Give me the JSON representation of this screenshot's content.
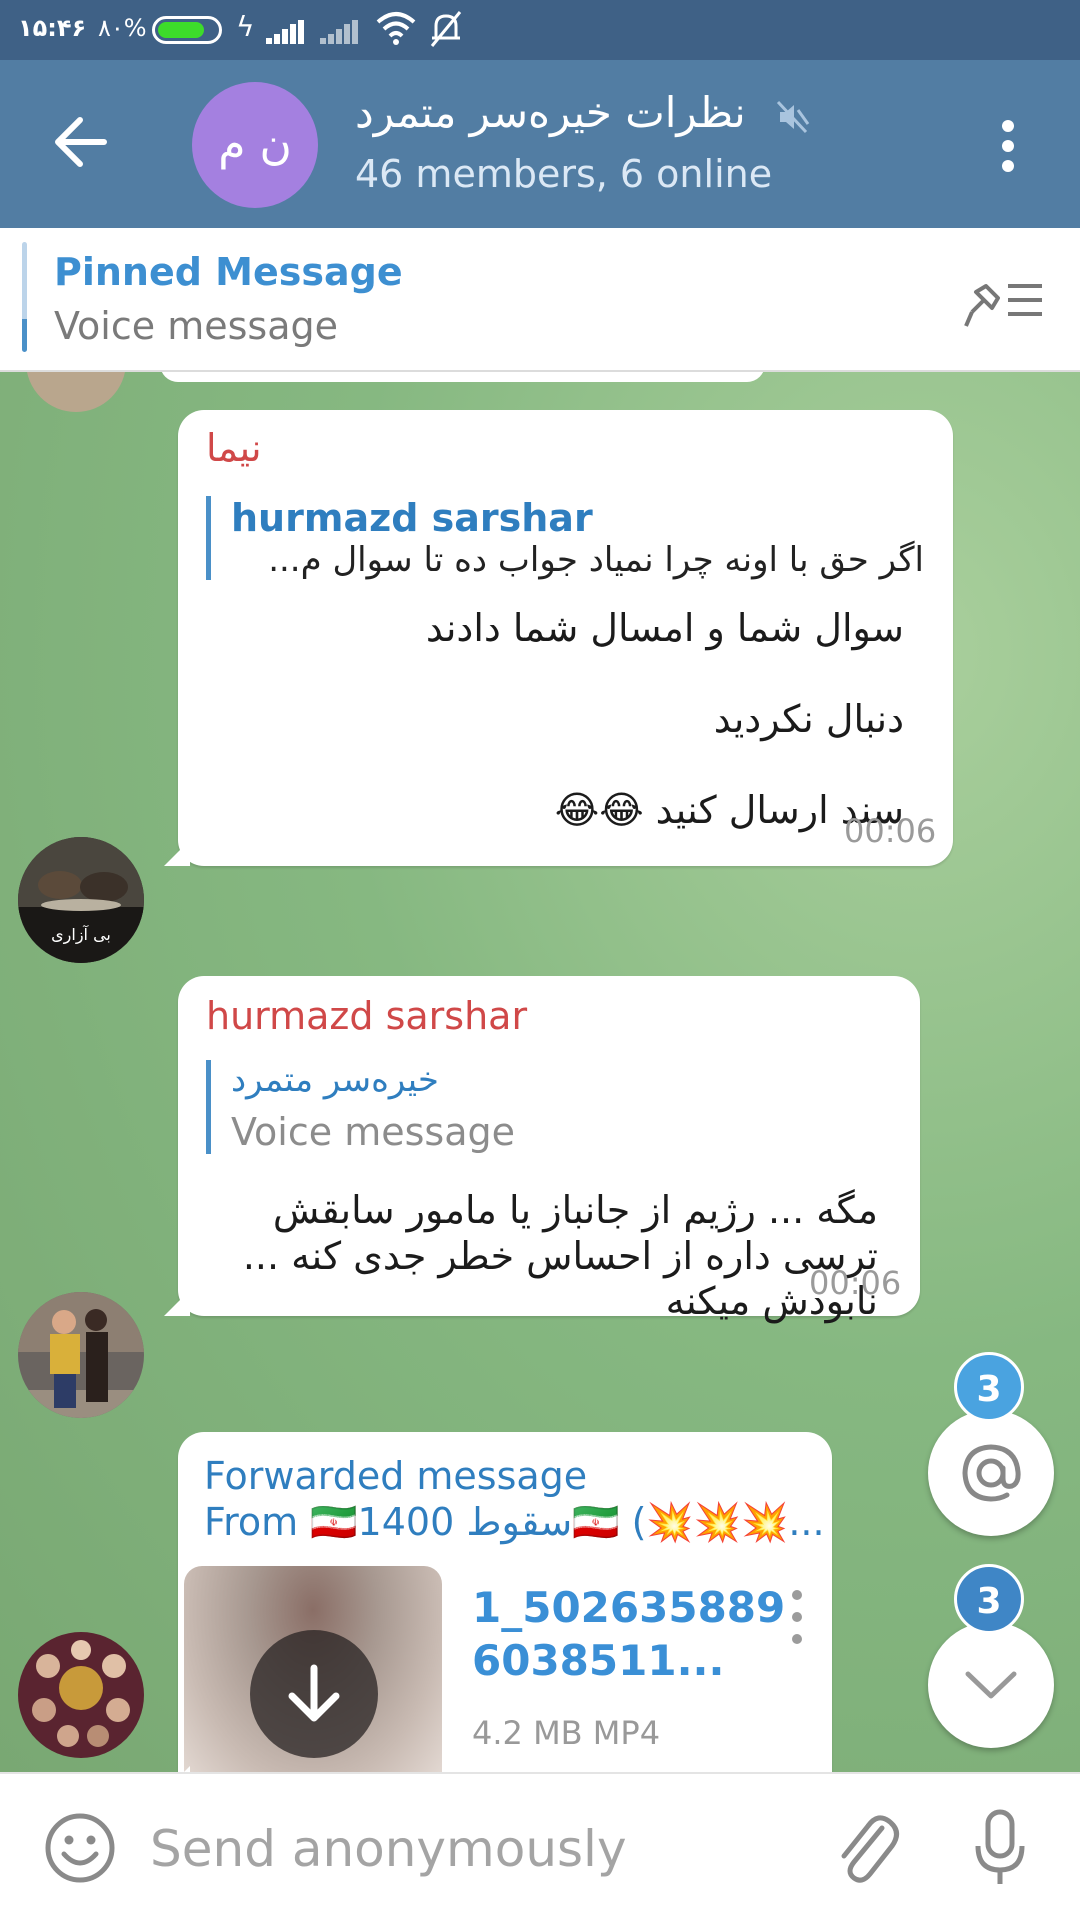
{
  "status_bar": {
    "time": "۱۵:۴۶",
    "battery_percent": "۸۰%",
    "battery_level": 0.8
  },
  "header": {
    "avatar_initials": "ن م",
    "title": "نظرات خیره‌سر متمرد",
    "subtitle": "46 members, 6 online"
  },
  "pinned": {
    "title": "Pinned Message",
    "text": "Voice message"
  },
  "messages": [
    {
      "sender": "نیما",
      "sender_color": "#d04848",
      "reply_name": "hurmazd sarshar",
      "reply_text": "اگر حق با اونه چرا نمیاد جواب ده تا سوال م...",
      "text": "سوال شما و امسال شما دادند\n\nدنبال نکردید\n\nسند ارسال کنید 😂😂",
      "time": "00:06",
      "avatar_label": "بی آزاری"
    },
    {
      "sender": "hurmazd sarshar",
      "sender_color": "#d04848",
      "reply_name": "خیره‌سر متمرد",
      "reply_text": "Voice message",
      "text": "مگه ... رژیم از جانباز یا مامور سابقش\nترسی داره از احساس خطر جدی کنه ...\nنابودش میکنه",
      "time": "00:06"
    },
    {
      "forward_label": "Forwarded message",
      "forward_from": "From 🇮🇷1400 سقوط🇮🇷 (💥💥💥...",
      "file_name_line1": "1_502635889",
      "file_name_line2": "6038511...",
      "file_meta": "4.2 MB MP4"
    }
  ],
  "fabs": {
    "mentions_count": "3",
    "scroll_down_count": "3"
  },
  "input": {
    "placeholder": "Send anonymously",
    "value": ""
  },
  "colors": {
    "header": "#527da3",
    "status_bar": "#3f6186",
    "accent": "#3d8fd1",
    "sender_red": "#d04848",
    "badge": "#4aa3e0"
  },
  "icons": [
    "back-arrow-icon",
    "mute-icon",
    "more-vert-icon",
    "pin-list-icon",
    "download-icon",
    "mention-icon",
    "chevron-down-icon",
    "emoji-icon",
    "attach-icon",
    "mic-icon"
  ]
}
